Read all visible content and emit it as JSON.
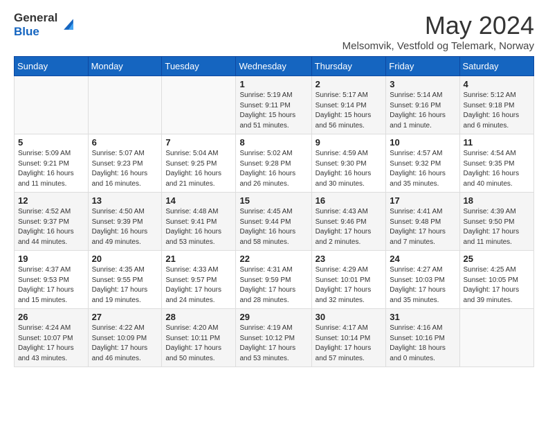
{
  "logo": {
    "general": "General",
    "blue": "Blue"
  },
  "title": "May 2024",
  "location": "Melsomvik, Vestfold og Telemark, Norway",
  "weekdays": [
    "Sunday",
    "Monday",
    "Tuesday",
    "Wednesday",
    "Thursday",
    "Friday",
    "Saturday"
  ],
  "weeks": [
    [
      {
        "day": "",
        "info": ""
      },
      {
        "day": "",
        "info": ""
      },
      {
        "day": "",
        "info": ""
      },
      {
        "day": "1",
        "info": "Sunrise: 5:19 AM\nSunset: 9:11 PM\nDaylight: 15 hours and 51 minutes."
      },
      {
        "day": "2",
        "info": "Sunrise: 5:17 AM\nSunset: 9:14 PM\nDaylight: 15 hours and 56 minutes."
      },
      {
        "day": "3",
        "info": "Sunrise: 5:14 AM\nSunset: 9:16 PM\nDaylight: 16 hours and 1 minute."
      },
      {
        "day": "4",
        "info": "Sunrise: 5:12 AM\nSunset: 9:18 PM\nDaylight: 16 hours and 6 minutes."
      }
    ],
    [
      {
        "day": "5",
        "info": "Sunrise: 5:09 AM\nSunset: 9:21 PM\nDaylight: 16 hours and 11 minutes."
      },
      {
        "day": "6",
        "info": "Sunrise: 5:07 AM\nSunset: 9:23 PM\nDaylight: 16 hours and 16 minutes."
      },
      {
        "day": "7",
        "info": "Sunrise: 5:04 AM\nSunset: 9:25 PM\nDaylight: 16 hours and 21 minutes."
      },
      {
        "day": "8",
        "info": "Sunrise: 5:02 AM\nSunset: 9:28 PM\nDaylight: 16 hours and 26 minutes."
      },
      {
        "day": "9",
        "info": "Sunrise: 4:59 AM\nSunset: 9:30 PM\nDaylight: 16 hours and 30 minutes."
      },
      {
        "day": "10",
        "info": "Sunrise: 4:57 AM\nSunset: 9:32 PM\nDaylight: 16 hours and 35 minutes."
      },
      {
        "day": "11",
        "info": "Sunrise: 4:54 AM\nSunset: 9:35 PM\nDaylight: 16 hours and 40 minutes."
      }
    ],
    [
      {
        "day": "12",
        "info": "Sunrise: 4:52 AM\nSunset: 9:37 PM\nDaylight: 16 hours and 44 minutes."
      },
      {
        "day": "13",
        "info": "Sunrise: 4:50 AM\nSunset: 9:39 PM\nDaylight: 16 hours and 49 minutes."
      },
      {
        "day": "14",
        "info": "Sunrise: 4:48 AM\nSunset: 9:41 PM\nDaylight: 16 hours and 53 minutes."
      },
      {
        "day": "15",
        "info": "Sunrise: 4:45 AM\nSunset: 9:44 PM\nDaylight: 16 hours and 58 minutes."
      },
      {
        "day": "16",
        "info": "Sunrise: 4:43 AM\nSunset: 9:46 PM\nDaylight: 17 hours and 2 minutes."
      },
      {
        "day": "17",
        "info": "Sunrise: 4:41 AM\nSunset: 9:48 PM\nDaylight: 17 hours and 7 minutes."
      },
      {
        "day": "18",
        "info": "Sunrise: 4:39 AM\nSunset: 9:50 PM\nDaylight: 17 hours and 11 minutes."
      }
    ],
    [
      {
        "day": "19",
        "info": "Sunrise: 4:37 AM\nSunset: 9:53 PM\nDaylight: 17 hours and 15 minutes."
      },
      {
        "day": "20",
        "info": "Sunrise: 4:35 AM\nSunset: 9:55 PM\nDaylight: 17 hours and 19 minutes."
      },
      {
        "day": "21",
        "info": "Sunrise: 4:33 AM\nSunset: 9:57 PM\nDaylight: 17 hours and 24 minutes."
      },
      {
        "day": "22",
        "info": "Sunrise: 4:31 AM\nSunset: 9:59 PM\nDaylight: 17 hours and 28 minutes."
      },
      {
        "day": "23",
        "info": "Sunrise: 4:29 AM\nSunset: 10:01 PM\nDaylight: 17 hours and 32 minutes."
      },
      {
        "day": "24",
        "info": "Sunrise: 4:27 AM\nSunset: 10:03 PM\nDaylight: 17 hours and 35 minutes."
      },
      {
        "day": "25",
        "info": "Sunrise: 4:25 AM\nSunset: 10:05 PM\nDaylight: 17 hours and 39 minutes."
      }
    ],
    [
      {
        "day": "26",
        "info": "Sunrise: 4:24 AM\nSunset: 10:07 PM\nDaylight: 17 hours and 43 minutes."
      },
      {
        "day": "27",
        "info": "Sunrise: 4:22 AM\nSunset: 10:09 PM\nDaylight: 17 hours and 46 minutes."
      },
      {
        "day": "28",
        "info": "Sunrise: 4:20 AM\nSunset: 10:11 PM\nDaylight: 17 hours and 50 minutes."
      },
      {
        "day": "29",
        "info": "Sunrise: 4:19 AM\nSunset: 10:12 PM\nDaylight: 17 hours and 53 minutes."
      },
      {
        "day": "30",
        "info": "Sunrise: 4:17 AM\nSunset: 10:14 PM\nDaylight: 17 hours and 57 minutes."
      },
      {
        "day": "31",
        "info": "Sunrise: 4:16 AM\nSunset: 10:16 PM\nDaylight: 18 hours and 0 minutes."
      },
      {
        "day": "",
        "info": ""
      }
    ]
  ]
}
